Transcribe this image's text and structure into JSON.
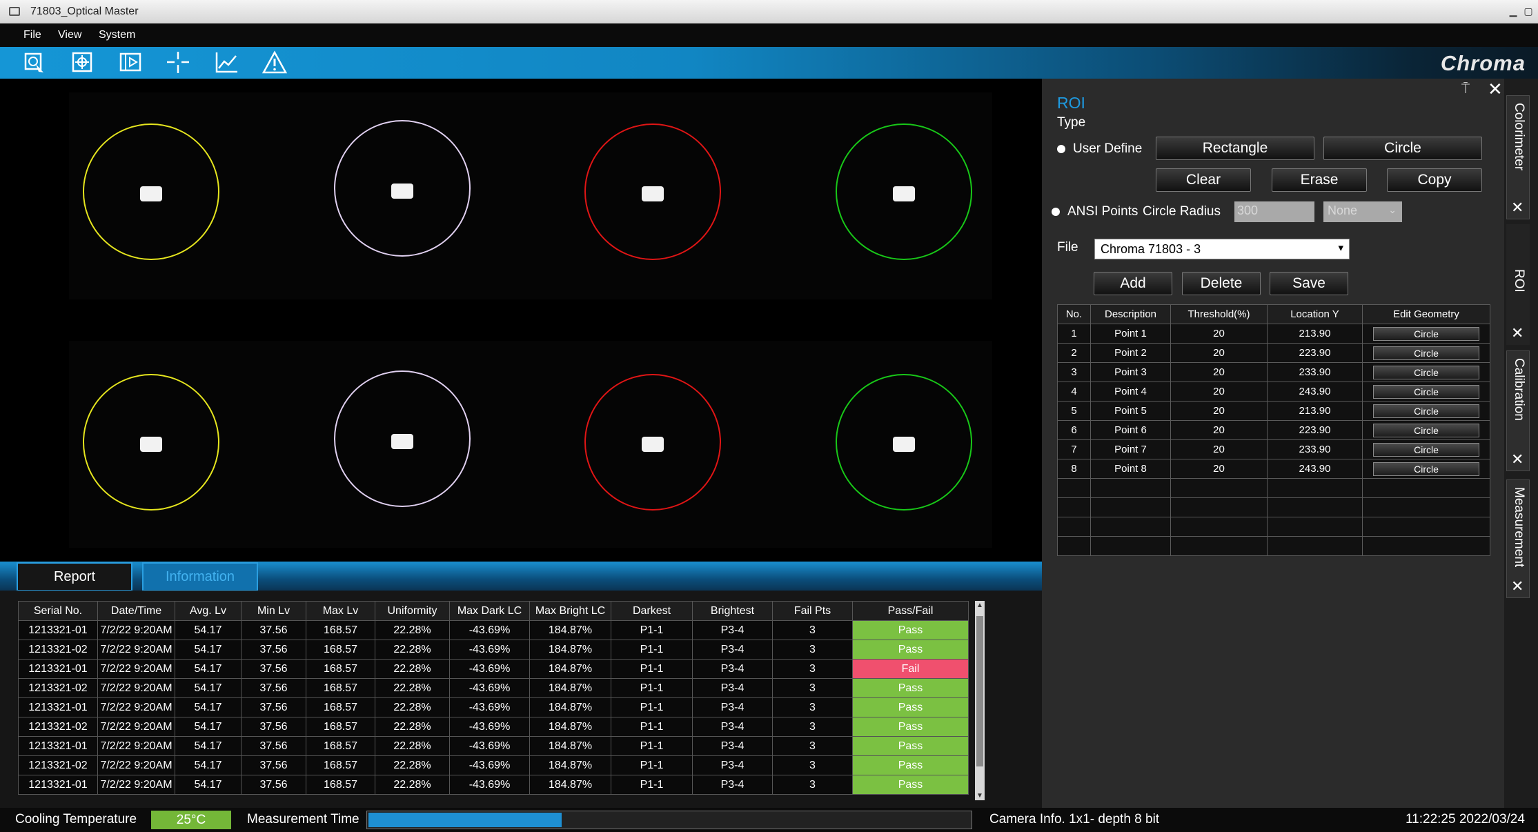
{
  "window": {
    "title": "71803_Optical Master"
  },
  "menu": {
    "items": [
      "File",
      "View",
      "System"
    ]
  },
  "toolbar": {
    "icons": [
      "roi-select-icon",
      "focus-target-icon",
      "video-play-icon",
      "crosshair-icon",
      "line-chart-icon",
      "warning-icon"
    ],
    "logo": "Chroma"
  },
  "roi_panel": {
    "title": "ROI",
    "type_label": "Type",
    "user_define_label": "User Define",
    "rectangle_btn": "Rectangle",
    "circle_btn": "Circle",
    "clear_btn": "Clear",
    "erase_btn": "Erase",
    "copy_btn": "Copy",
    "ansi_label": "ANSI Points",
    "circle_radius_label": "Circle Radius",
    "radius_value": "300",
    "none_select": "None",
    "file_label": "File",
    "file_value": "Chroma 71803 - 3",
    "add_btn": "Add",
    "delete_btn": "Delete",
    "save_btn": "Save",
    "table": {
      "headers": [
        "No.",
        "Description",
        "Threshold(%)",
        "Location Y",
        "Edit Geometry"
      ],
      "rows": [
        [
          "1",
          "Point 1",
          "20",
          "213.90",
          "Circle"
        ],
        [
          "2",
          "Point 2",
          "20",
          "223.90",
          "Circle"
        ],
        [
          "3",
          "Point 3",
          "20",
          "233.90",
          "Circle"
        ],
        [
          "4",
          "Point 4",
          "20",
          "243.90",
          "Circle"
        ],
        [
          "5",
          "Point 5",
          "20",
          "213.90",
          "Circle"
        ],
        [
          "6",
          "Point 6",
          "20",
          "223.90",
          "Circle"
        ],
        [
          "7",
          "Point 7",
          "20",
          "233.90",
          "Circle"
        ],
        [
          "8",
          "Point 8",
          "20",
          "243.90",
          "Circle"
        ]
      ]
    }
  },
  "side_tabs": [
    "Colorimeter",
    "ROI",
    "Calibration",
    "Measurement"
  ],
  "viewer": {
    "circle_colors": [
      "#e6e61e",
      "#e0d0f0",
      "#e01515",
      "#18c818"
    ]
  },
  "bottom_tabs": {
    "report": "Report",
    "information": "Information"
  },
  "report": {
    "headers": [
      "Serial No.",
      "Date/Time",
      "Avg. Lv",
      "Min Lv",
      "Max Lv",
      "Uniformity",
      "Max Dark LC",
      "Max Bright LC",
      "Darkest",
      "Brightest",
      "Fail Pts",
      "Pass/Fail"
    ],
    "rows": [
      [
        "1213321-01",
        "7/2/22 9:20AM",
        "54.17",
        "37.56",
        "168.57",
        "22.28%",
        "-43.69%",
        "184.87%",
        "P1-1",
        "P3-4",
        "3",
        "Pass"
      ],
      [
        "1213321-02",
        "7/2/22 9:20AM",
        "54.17",
        "37.56",
        "168.57",
        "22.28%",
        "-43.69%",
        "184.87%",
        "P1-1",
        "P3-4",
        "3",
        "Pass"
      ],
      [
        "1213321-01",
        "7/2/22 9:20AM",
        "54.17",
        "37.56",
        "168.57",
        "22.28%",
        "-43.69%",
        "184.87%",
        "P1-1",
        "P3-4",
        "3",
        "Fail"
      ],
      [
        "1213321-02",
        "7/2/22 9:20AM",
        "54.17",
        "37.56",
        "168.57",
        "22.28%",
        "-43.69%",
        "184.87%",
        "P1-1",
        "P3-4",
        "3",
        "Pass"
      ],
      [
        "1213321-01",
        "7/2/22 9:20AM",
        "54.17",
        "37.56",
        "168.57",
        "22.28%",
        "-43.69%",
        "184.87%",
        "P1-1",
        "P3-4",
        "3",
        "Pass"
      ],
      [
        "1213321-02",
        "7/2/22 9:20AM",
        "54.17",
        "37.56",
        "168.57",
        "22.28%",
        "-43.69%",
        "184.87%",
        "P1-1",
        "P3-4",
        "3",
        "Pass"
      ],
      [
        "1213321-01",
        "7/2/22 9:20AM",
        "54.17",
        "37.56",
        "168.57",
        "22.28%",
        "-43.69%",
        "184.87%",
        "P1-1",
        "P3-4",
        "3",
        "Pass"
      ],
      [
        "1213321-02",
        "7/2/22 9:20AM",
        "54.17",
        "37.56",
        "168.57",
        "22.28%",
        "-43.69%",
        "184.87%",
        "P1-1",
        "P3-4",
        "3",
        "Pass"
      ],
      [
        "1213321-01",
        "7/2/22 9:20AM",
        "54.17",
        "37.56",
        "168.57",
        "22.28%",
        "-43.69%",
        "184.87%",
        "P1-1",
        "P3-4",
        "3",
        "Pass"
      ]
    ],
    "pass_color": "#7bc142",
    "fail_color": "#f0506e"
  },
  "status": {
    "cooling_label": "Cooling Temperature",
    "cooling_value": "25°C",
    "measurement_label": "Measurement Time",
    "measurement_progress": 0.32,
    "camera_info": "Camera Info. 1x1- depth 8 bit",
    "datetime": "11:22:25 2022/03/24"
  }
}
